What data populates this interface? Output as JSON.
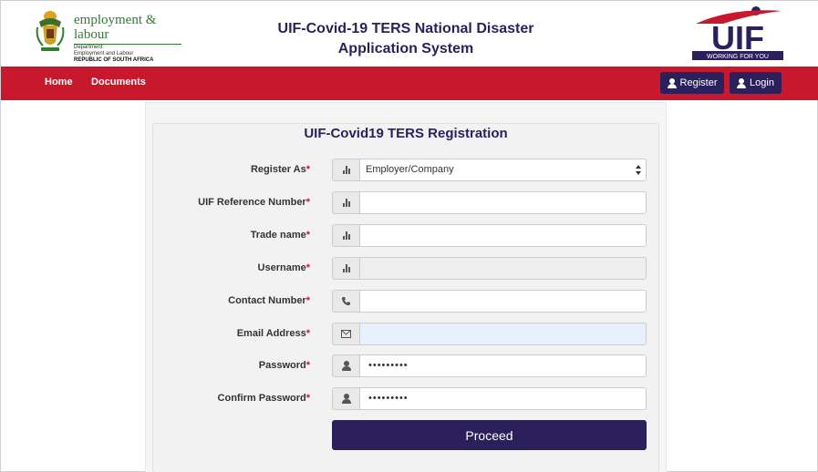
{
  "header": {
    "dept_name": "employment & labour",
    "dept_line1": "Department:",
    "dept_line2": "Employment and Labour",
    "dept_line3": "REPUBLIC OF SOUTH AFRICA",
    "title_line1": "UIF-Covid-19 TERS National Disaster",
    "title_line2": "Application System",
    "uif_logo_text": "UIF",
    "uif_logo_tagline": "WORKING FOR YOU"
  },
  "nav": {
    "home": "Home",
    "documents": "Documents",
    "register": "Register",
    "login": "Login"
  },
  "form": {
    "title": "UIF-Covid19 TERS Registration",
    "fields": [
      {
        "label": "Register As",
        "required": "*",
        "icon": "bar-chart-icon",
        "type": "select",
        "value": "Employer/Company"
      },
      {
        "label": "UIF Reference Number",
        "required": "*",
        "icon": "bar-chart-icon",
        "type": "text",
        "value": ""
      },
      {
        "label": "Trade name",
        "required": "*",
        "icon": "bar-chart-icon",
        "type": "text",
        "value": ""
      },
      {
        "label": "Username",
        "required": "*",
        "icon": "bar-chart-icon",
        "type": "text",
        "value": ""
      },
      {
        "label": "Contact Number",
        "required": "*",
        "icon": "phone-icon",
        "type": "text",
        "value": ""
      },
      {
        "label": "Email Address",
        "required": "*",
        "icon": "envelope-icon",
        "type": "text",
        "value": ""
      },
      {
        "label": "Password",
        "required": "*",
        "icon": "user-icon",
        "type": "password",
        "value": "•••••••••"
      },
      {
        "label": "Confirm Password",
        "required": "*",
        "icon": "user-icon",
        "type": "password",
        "value": "•••••••••"
      }
    ],
    "proceed_label": "Proceed"
  },
  "colors": {
    "brand_navy": "#2b1f5c",
    "brand_red": "#c8182d",
    "dept_green": "#2e7d32"
  }
}
